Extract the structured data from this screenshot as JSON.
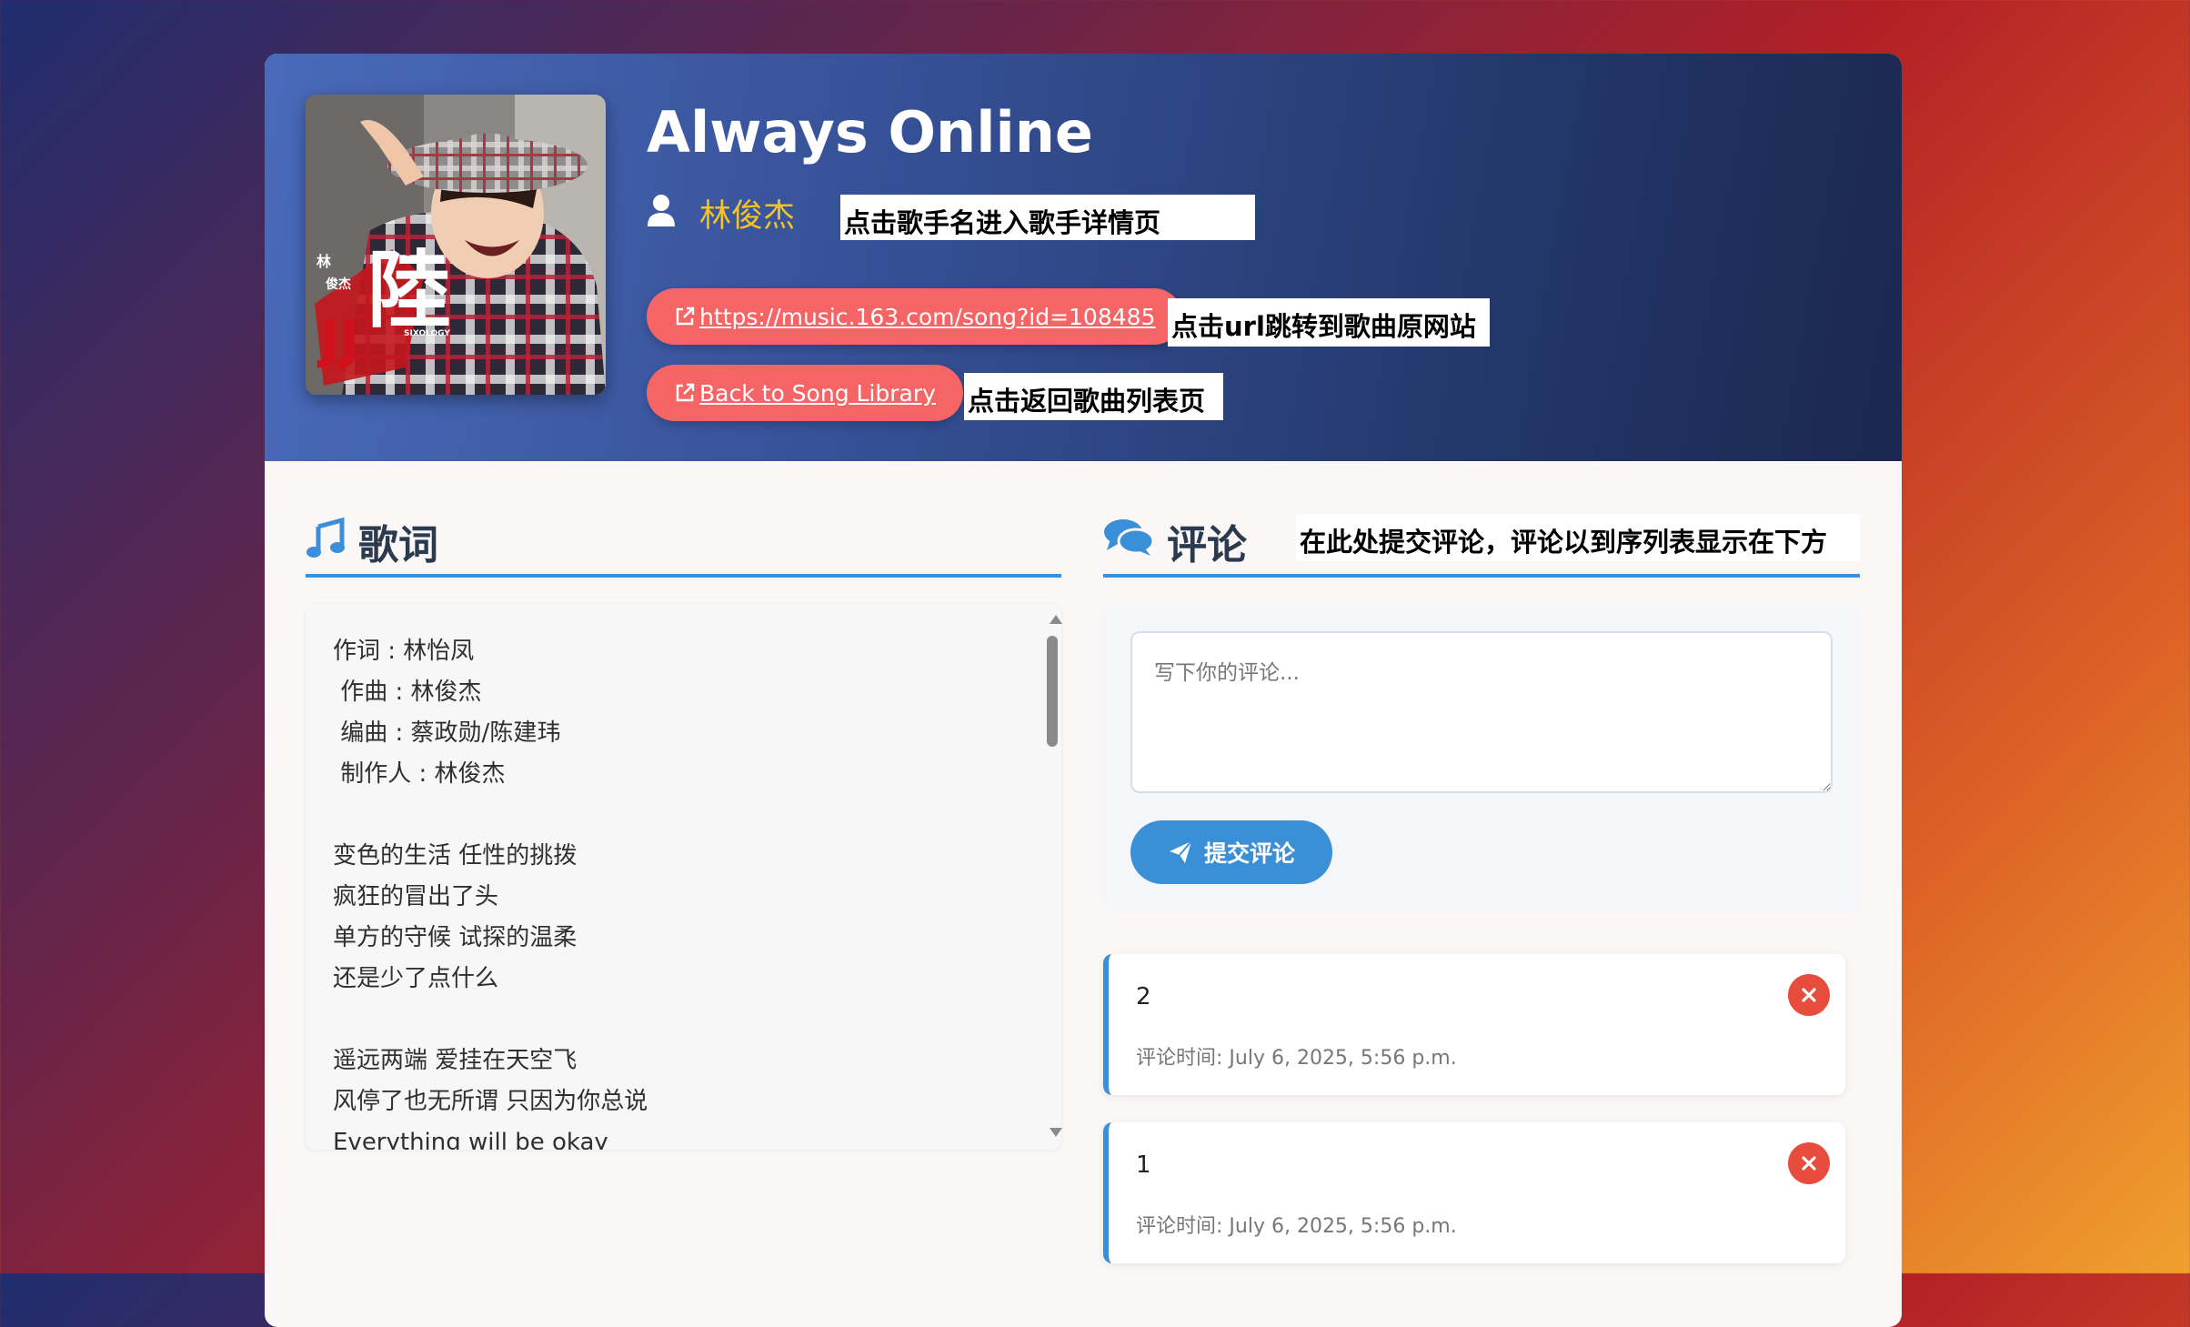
{
  "song": {
    "title": "Always Online",
    "artist": "林俊杰",
    "url": "https://music.163.com/song?id=108485",
    "back_label": "Back to Song Library"
  },
  "notes": {
    "artist": "点击歌手名进入歌手详情页",
    "url": "点击url跳转到歌曲原网站",
    "back": "点击返回歌曲列表页",
    "comments": "在此处提交评论，评论以到序列表显示在下方"
  },
  "lyrics": {
    "heading": "歌词",
    "text": "作词 : 林怡凤\n 作曲 : 林俊杰\n 编曲 : 蔡政勋/陈建玮\n 制作人 : 林俊杰\n\n变色的生活 任性的挑拨\n疯狂的冒出了头\n单方的守候 试探的温柔\n还是少了点什么\n\n遥远两端 爱挂在天空飞\n风停了也无所谓 只因为你总说\nEverything will be okay"
  },
  "comments": {
    "heading": "评论",
    "placeholder": "写下你的评论...",
    "submit_label": "提交评论",
    "items": [
      {
        "text": "2",
        "time": "评论时间: July 6, 2025, 5:56 p.m."
      },
      {
        "text": "1",
        "time": "评论时间: July 6, 2025, 5:56 p.m."
      }
    ]
  },
  "cover": {
    "text_top": "林",
    "text_name": "俊杰",
    "text_big": "陸",
    "text_jj": "JJ",
    "text_small": "SIXOLOGY"
  },
  "colors": {
    "accent": "#3a8fd6",
    "pill": "#f56565",
    "artist": "#f5c323",
    "delete": "#e74c3c"
  }
}
